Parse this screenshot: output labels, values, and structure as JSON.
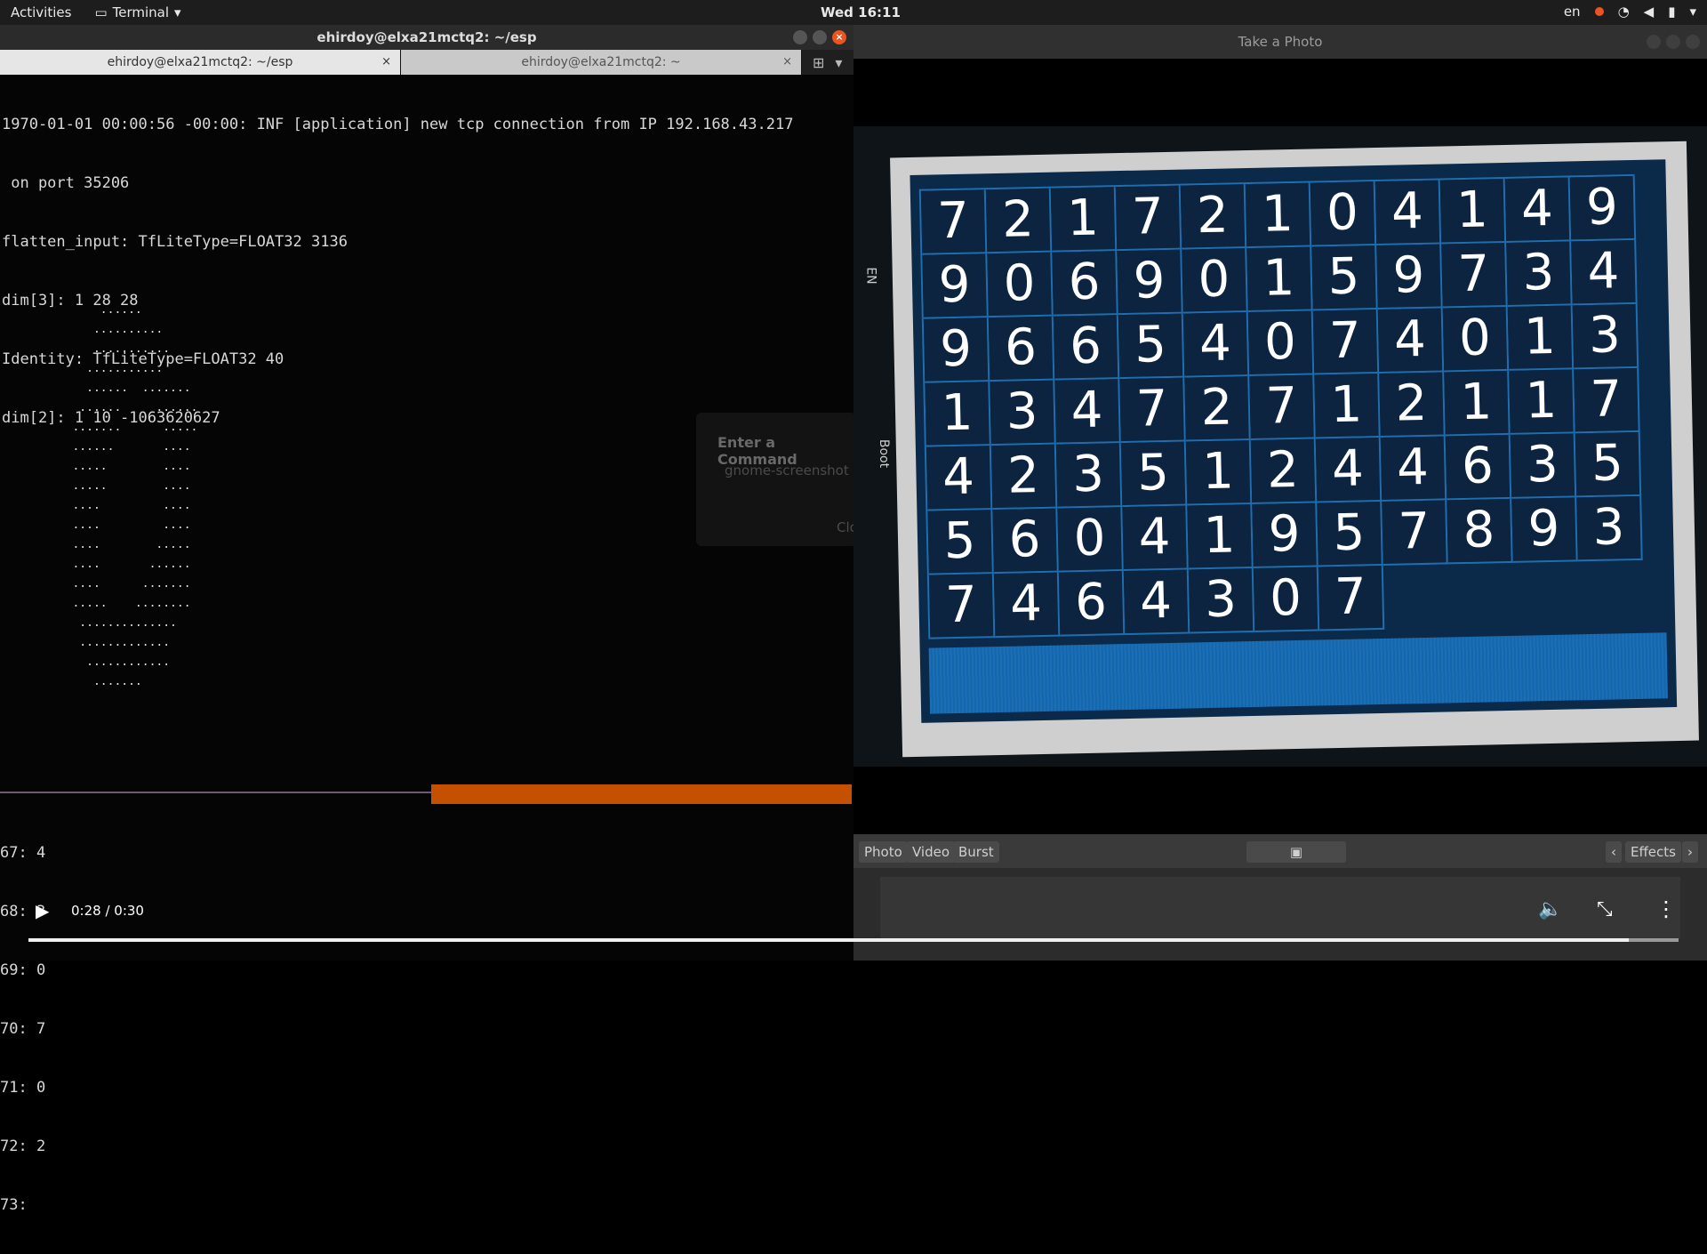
{
  "topbar": {
    "activities": "Activities",
    "app_name": "Terminal",
    "clock": "Wed 16:11",
    "lang": "en"
  },
  "terminal": {
    "title": "ehirdoy@elxa21mctq2: ~/esp",
    "tabs": [
      {
        "label": "ehirdoy@elxa21mctq2: ~/esp"
      },
      {
        "label": "ehirdoy@elxa21mctq2: ~"
      }
    ],
    "output_lines": [
      "1970-01-01 00:00:56 -00:00: INF [application] new tcp connection from IP 192.168.43.217",
      " on port 35206",
      "flatten_input: TfLiteType=FLOAT32 3136",
      "dim[3]: 1 28 28",
      "Identity: TfLiteType=FLOAT32 40",
      "dim[2]: 1 10 -1063620627"
    ],
    "ascii_art": "       ......\n      ..........\n      ...........\n     ...........\n     ......  .......\n    ......     ......\n   .......      .....\n   ......       ....\n   .....        ....\n   .....        ....\n   ....         ....\n   ....         ....\n   ....        .....\n   ....       ......\n   ....      .......\n   .....    ........\n    ..............\n    .............\n     ............\n      .......",
    "results": [
      "67: 4",
      "68: 3",
      "69: 0",
      "70: 7",
      "71: 0",
      "72: 2",
      "73: "
    ]
  },
  "video": {
    "time": "0:28 / 0:30",
    "progress": 0.97
  },
  "command_dialog": {
    "title": "Enter a Command",
    "value": "gnome-screenshot",
    "close": "Close"
  },
  "camera": {
    "title": "Take a Photo",
    "modes": [
      "Photo",
      "Video",
      "Burst"
    ],
    "effects": "Effects",
    "labels": {
      "boot": "Boot",
      "en": "EN"
    },
    "digits": [
      [
        "7",
        "2",
        "1",
        "7",
        "2",
        "1",
        "0",
        "4",
        "1",
        "4",
        "9"
      ],
      [
        "9",
        "0",
        "6",
        "9",
        "0",
        "1",
        "5",
        "9",
        "7",
        "3",
        "4"
      ],
      [
        "9",
        "6",
        "6",
        "5",
        "4",
        "0",
        "7",
        "4",
        "0",
        "1",
        "3"
      ],
      [
        "1",
        "3",
        "4",
        "7",
        "2",
        "7",
        "1",
        "2",
        "1",
        "1",
        "7"
      ],
      [
        "4",
        "2",
        "3",
        "5",
        "1",
        "2",
        "4",
        "4",
        "6",
        "3",
        "5"
      ],
      [
        "5",
        "6",
        "0",
        "4",
        "1",
        "9",
        "5",
        "7",
        "8",
        "9",
        "3"
      ],
      [
        "7",
        "4",
        "6",
        "4",
        "3",
        "0",
        "7"
      ]
    ]
  }
}
